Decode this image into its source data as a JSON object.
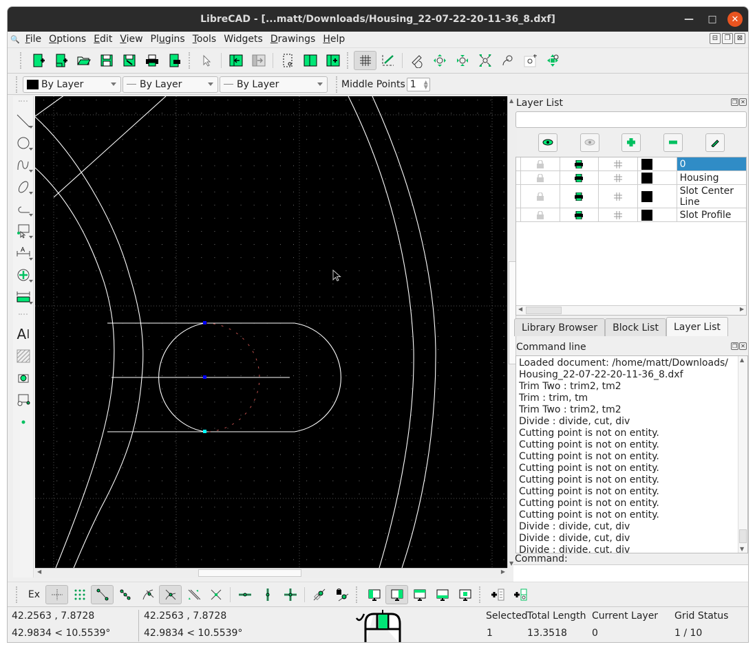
{
  "window": {
    "title": "LibreCAD - [...matt/Downloads/Housing_22-07-22-20-11-36_8.dxf]",
    "minimize_icon": "minimize-icon",
    "maximize_icon": "maximize-icon",
    "close_icon": "close-icon"
  },
  "menu": {
    "items": [
      {
        "label": "File",
        "accel": "F"
      },
      {
        "label": "Options",
        "accel": "O"
      },
      {
        "label": "Edit",
        "accel": "E"
      },
      {
        "label": "View",
        "accel": "V"
      },
      {
        "label": "Plugins",
        "accel": "u"
      },
      {
        "label": "Tools",
        "accel": "T"
      },
      {
        "label": "Widgets",
        "accel": ""
      },
      {
        "label": "Drawings",
        "accel": "D"
      },
      {
        "label": "Help",
        "accel": "H"
      }
    ]
  },
  "main_toolbar": {
    "items": [
      "new-icon",
      "new-from-template-icon",
      "open-icon",
      "save-icon",
      "save-as-icon",
      "print-icon",
      "print-preview-icon",
      "select-pointer-icon",
      "back-icon",
      "forward-icon",
      "cut-selection-icon",
      "copy-icon",
      "paste-icon",
      "grid-icon",
      "draft-icon",
      "redraw-icon",
      "zoom-in-icon",
      "zoom-out-icon",
      "zoom-auto-icon",
      "zoom-previous-icon",
      "zoom-window-icon",
      "zoom-pan-icon"
    ]
  },
  "pen_toolbar": {
    "color": "By Layer",
    "width": "By Layer",
    "linetype": "By Layer",
    "middle_points_label": "Middle Points",
    "middle_points_value": "1"
  },
  "layer_list": {
    "title": "Layer List",
    "filter_placeholder": "",
    "buttons": [
      "show-all-layers",
      "hide-all-layers",
      "add-layer",
      "remove-layer",
      "edit-layer"
    ],
    "layers": [
      {
        "name": "0",
        "selected": true,
        "color": "#000000"
      },
      {
        "name": "Housing",
        "selected": false,
        "color": "#000000"
      },
      {
        "name": "Slot Center Line",
        "selected": false,
        "color": "#000000"
      },
      {
        "name": "Slot Profile",
        "selected": false,
        "color": "#000000"
      }
    ]
  },
  "dock_tabs": [
    {
      "label": "Library Browser",
      "active": false
    },
    {
      "label": "Block List",
      "active": false
    },
    {
      "label": "Layer List",
      "active": true
    }
  ],
  "command_line": {
    "title": "Command line",
    "log": [
      "Loaded document: /home/matt/Downloads/",
      "Housing_22-07-22-20-11-36_8.dxf",
      "Trim Two : trim2, tm2",
      "Trim : trim, tm",
      "Trim Two : trim2, tm2",
      "Divide : divide, cut, div",
      "Cutting point is not on entity.",
      "Cutting point is not on entity.",
      "Cutting point is not on entity.",
      "Cutting point is not on entity.",
      "Cutting point is not on entity.",
      "Cutting point is not on entity.",
      "Cutting point is not on entity.",
      "Cutting point is not on entity.",
      "Divide : divide, cut, div",
      "Divide : divide, cut, div",
      "Divide : divide, cut, div"
    ],
    "prompt": "Command:",
    "input_value": ""
  },
  "snap_toolbar": {
    "exclusive_label": "Ex"
  },
  "status": {
    "abs_coord": "42.2563 , 7.8728",
    "abs_polar": "42.9834 < 10.5539°",
    "rel_coord": "42.2563 , 7.8728",
    "rel_polar": "42.9834 < 10.5539°",
    "selected_label": "Selected",
    "selected_value": "1",
    "total_length_label": "Total Length",
    "total_length_value": "13.3518",
    "current_layer_label": "Current Layer",
    "current_layer_value": "0",
    "grid_status_label": "Grid Status",
    "grid_status_value": "1 / 10"
  },
  "colors": {
    "accent_green": "#00e676",
    "selection_blue": "#308cc6",
    "close_orange": "#e95420",
    "canvas_bg": "#000000"
  }
}
